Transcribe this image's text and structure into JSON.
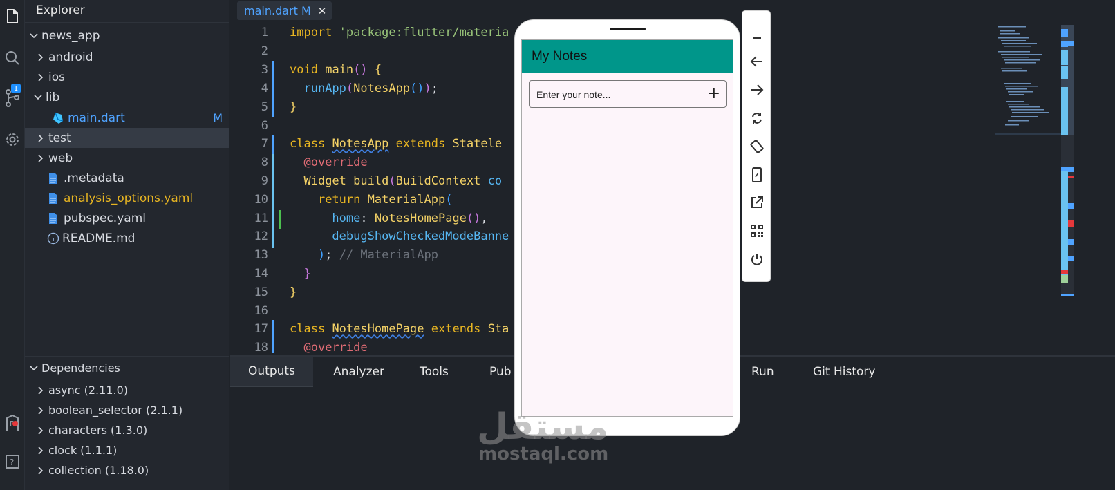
{
  "activity_bar": {
    "items": [
      {
        "icon": "files-icon"
      },
      {
        "icon": "search-icon"
      },
      {
        "icon": "source-control-icon",
        "badge": "1"
      },
      {
        "icon": "gear-icon"
      },
      {
        "icon": "remote-icon"
      },
      {
        "icon": "help-icon"
      }
    ]
  },
  "explorer": {
    "title": "Explorer",
    "items": [
      {
        "label": "news_app",
        "expanded": true
      },
      {
        "label": "android",
        "expanded": false
      },
      {
        "label": "ios",
        "expanded": false
      },
      {
        "label": "lib",
        "expanded": true
      },
      {
        "label": "main.dart",
        "badge": "M",
        "color": "#4fa3ff"
      },
      {
        "label": "test",
        "expanded": false
      },
      {
        "label": "web",
        "expanded": false
      },
      {
        "label": ".metadata"
      },
      {
        "label": "analysis_options.yaml",
        "color": "#e6b422"
      },
      {
        "label": "pubspec.yaml"
      },
      {
        "label": "README.md"
      }
    ]
  },
  "dependencies": {
    "title": "Dependencies",
    "items": [
      {
        "label": "async (2.11.0)"
      },
      {
        "label": "boolean_selector (2.1.1)"
      },
      {
        "label": "characters (1.3.0)"
      },
      {
        "label": "clock (1.1.1)"
      },
      {
        "label": "collection (1.18.0)"
      }
    ]
  },
  "editor": {
    "tab_label": "main.dart M",
    "tab_close": "✕",
    "line_numbers": [
      "1",
      "2",
      "3",
      "4",
      "5",
      "6",
      "7",
      "8",
      "9",
      "10",
      "11",
      "12",
      "13",
      "14",
      "15",
      "16",
      "17",
      "18"
    ]
  },
  "panel": {
    "tabs": [
      "Outputs",
      "Analyzer",
      "Tools",
      "Pub",
      "Run",
      "Git History"
    ],
    "active": "Outputs"
  },
  "phone": {
    "appbar_title": "My Notes",
    "input_placeholder": "Enter your note...",
    "add_glyph": "+",
    "appbar_color": "#00968a"
  },
  "watermark": {
    "logo": "مستقل",
    "text": "mostaql.com"
  }
}
